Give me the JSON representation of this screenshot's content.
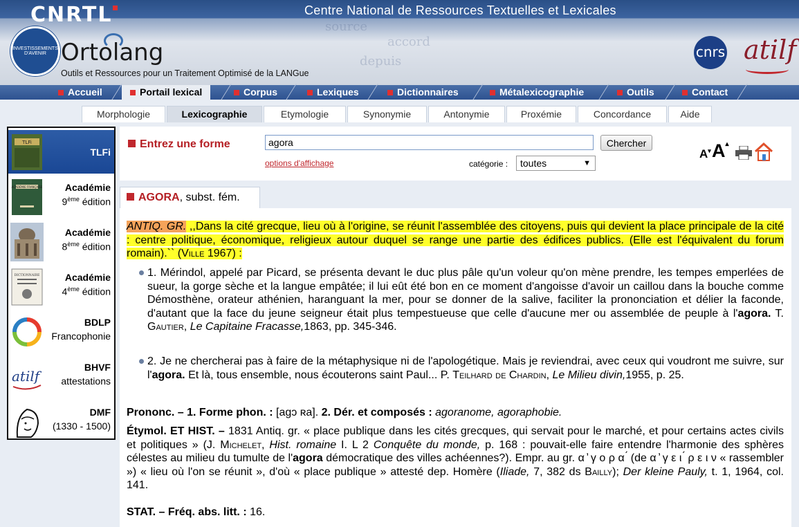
{
  "header": {
    "logo": "CNRTL",
    "title": "Centre National de Ressources Textuelles et Lexicales",
    "seal_text": "INVESTISSEMENTS D'AVENIR",
    "ortolang": "Ortolang",
    "ortolang_subtitle": "Outils et Ressources pour un Traitement Optimisé de la LANGue",
    "cnrs": "cnrs",
    "atilf": "atilf"
  },
  "nav": {
    "items": [
      "Accueil",
      "Portail lexical",
      "Corpus",
      "Lexiques",
      "Dictionnaires",
      "Métalexicographie",
      "Outils",
      "Contact"
    ],
    "active": "Portail lexical"
  },
  "subtabs": {
    "items": [
      "Morphologie",
      "Lexicographie",
      "Etymologie",
      "Synonymie",
      "Antonymie",
      "Proxémie",
      "Concordance",
      "Aide"
    ],
    "active": "Lexicographie"
  },
  "sidebar": {
    "items": [
      {
        "name": "TLFi",
        "sub": "",
        "sup": "",
        "sub2": ""
      },
      {
        "name": "Académie",
        "sub": "9",
        "sup": "ème",
        "sub2": " édition"
      },
      {
        "name": "Académie",
        "sub": "8",
        "sup": "ème",
        "sub2": " édition"
      },
      {
        "name": "Académie",
        "sub": "4",
        "sup": "ème",
        "sub2": " édition"
      },
      {
        "name": "BDLP",
        "sub": "Francophonie",
        "sup": "",
        "sub2": ""
      },
      {
        "name": "BHVF",
        "sub": "attestations",
        "sup": "",
        "sub2": ""
      },
      {
        "name": "DMF",
        "sub": "(1330 - 1500)",
        "sup": "",
        "sub2": ""
      }
    ],
    "thumb_texts": {
      "tlfi": "TLFi",
      "ac9": "ACADÉMIE FRANÇAISE",
      "ac4": "DICTIONNAIRE",
      "atilf": "atilf"
    }
  },
  "search": {
    "label": "Entrez une forme",
    "value": "agora",
    "button": "Chercher",
    "options_link": "options d'affichage",
    "category_label": "catégorie :",
    "category_value": "toutes"
  },
  "tools": {
    "font_small": "A",
    "font_large": "A"
  },
  "article": {
    "tab_headword": "AGORA",
    "tab_pos": ", subst. fém.",
    "domain": "ANTIQ. GR.",
    "definition": " ,,Dans la cité grecque, lieu où à l'origine, se réunit l'assemblée des citoyens, puis qui devient la place principale de la cité : centre politique, économique, religieux autour duquel se range une partie des édifices publics. (Elle est l'équivalent du forum romain).`` (",
    "def_source": "Ville",
    "def_end": " 1967) :",
    "ex1": {
      "text": "1. Mérindol, appelé par Picard, se présenta devant le duc plus pâle qu'un voleur qu'on mène prendre, les tempes emperlées de sueur, la gorge sèche et la langue empâtée; il lui eût été bon en ce moment d'angoisse d'avoir un caillou dans la bouche comme Démosthène, orateur athénien, haranguant la mer, pour se donner de la salive, faciliter la prononciation et délier la faconde, d'autant que la face du jeune seigneur était plus tempestueuse que celle d'aucune mer ou assemblée de peuple à l'",
      "keyword": "agora.",
      "author_initial": " T. ",
      "author": "Gautier",
      "sep": ", ",
      "work": "Le Capitaine Fracasse,",
      "ref": "1863, pp. 345-346."
    },
    "ex2": {
      "text": "2. Je ne chercherai pas à faire de la métaphysique ni de l'apologétique. Mais je reviendrai, avec ceux qui voudront me suivre, sur l'",
      "keyword": "agora.",
      "text2": " Et là, tous ensemble, nous écouterons saint Paul... P. ",
      "author": "Teilhard de Chardin",
      "sep": ", ",
      "work": "Le Milieu divin,",
      "ref": "1955, p. 25."
    },
    "prononc": {
      "label": "Prononc. – 1. Forme phon. :",
      "phon": " [agɔ ʀa]. ",
      "label2": "2. Dér. et composés :",
      "derived": " agoranome, agoraphobie."
    },
    "etym": {
      "label": "Étymol. ET HIST. –",
      "t1": " 1831 Antiq. gr. « place publique dans les cités grecques, qui servait pour le marché, et pour certains actes civils et politiques » (J. ",
      "a1": "Michelet",
      "t2": ", ",
      "w1": "Hist. romaine",
      "t3": " I. L 2 ",
      "w2": "Conquête du monde,",
      "t4": " p. 168 : pouvait-elle faire entendre l'harmonie des sphères célestes au milieu du tumulte de l'",
      "kw": "agora",
      "t5": " démocratique des villes achéennes?). Empr. au gr. α ̓ γ ο ρ α ́ (de α ̓ γ ε ι ́ ρ ε ι ν « rassembler ») « lieu où l'on se réunit », d'où « place publique » attesté dep. Homère (",
      "w3": "Iliade,",
      "t6": " 7, 382 ds ",
      "a2": "Bailly",
      "t7": "); ",
      "w4": "Der kleine Pauly,",
      "t8": " t. 1, 1964, col. 141."
    },
    "stat": {
      "label": "STAT. – Fréq. abs. litt. :",
      "value": " 16."
    }
  }
}
